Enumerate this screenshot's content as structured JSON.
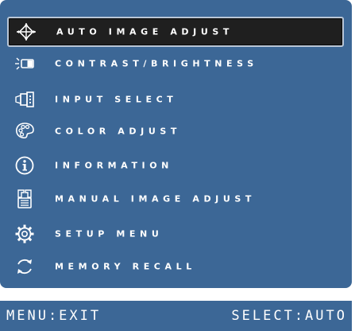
{
  "colors": {
    "panel": "#3c6796",
    "selected_bg": "#1f1f1f",
    "text": "#ffffff"
  },
  "menu": {
    "items": [
      {
        "label": "AUTO IMAGE ADJUST",
        "icon": "auto-adjust-icon",
        "selected": true
      },
      {
        "label": "CONTRAST/BRIGHTNESS",
        "icon": "contrast-brightness-icon",
        "selected": false
      },
      {
        "label": "INPUT SELECT",
        "icon": "input-connector-icon",
        "selected": false
      },
      {
        "label": "COLOR ADJUST",
        "icon": "color-palette-icon",
        "selected": false
      },
      {
        "label": "INFORMATION",
        "icon": "info-icon",
        "selected": false
      },
      {
        "label": "MANUAL IMAGE ADJUST",
        "icon": "manual-adjust-icon",
        "selected": false
      },
      {
        "label": "SETUP MENU",
        "icon": "gear-icon",
        "selected": false
      },
      {
        "label": "MEMORY RECALL",
        "icon": "recall-arrows-icon",
        "selected": false
      }
    ]
  },
  "status": {
    "left": "MENU:EXIT",
    "right": "SELECT:AUTO"
  }
}
